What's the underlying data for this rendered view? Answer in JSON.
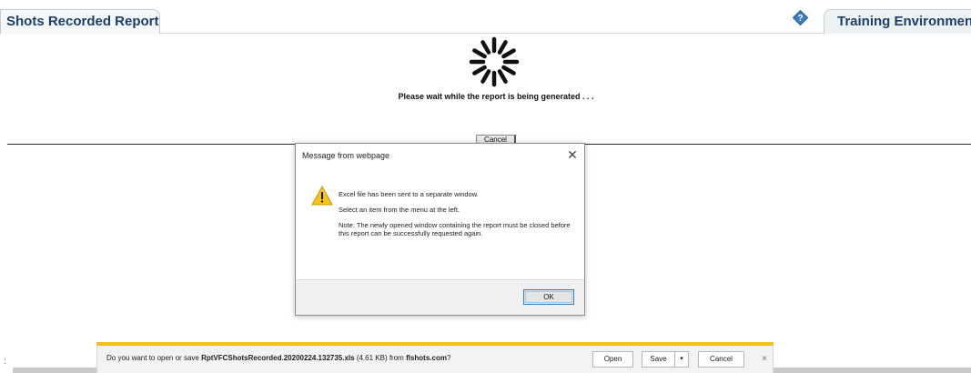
{
  "header": {
    "report_tab_label": "Shots Recorded Report",
    "help_icon": "help-diamond-icon",
    "environment_tab_label": "Training Environment"
  },
  "loading": {
    "spinner_icon": "loading-spinner-icon",
    "message": "Please wait while the report is being generated . . .",
    "cancel_label": "Cancel"
  },
  "dialog": {
    "title": "Message from webpage",
    "close_icon": "close-icon",
    "warning_icon": "warning-icon",
    "line1": "Excel file has been sent to a separate window.",
    "line2": "Select an item from the menu at the left.",
    "line3": "Note: The newly opened window containing the report must be closed before this report can be successfully requested again.",
    "ok_label": "OK"
  },
  "download_bar": {
    "prefix": "Do you want to open or save ",
    "file_name": "RptVFCShotsRecorded.20200224.132735.xls",
    "size_text": " (4.61 KB) from ",
    "site": "flshots.com",
    "suffix": "?",
    "open_label": "Open",
    "save_label": "Save",
    "save_arrow": "▾",
    "cancel_label": "Cancel",
    "close_glyph": "×"
  },
  "colors": {
    "tab_text": "#1c3f6e",
    "notification_accent": "#f3c21a",
    "warning_yellow": "#f5c518"
  }
}
